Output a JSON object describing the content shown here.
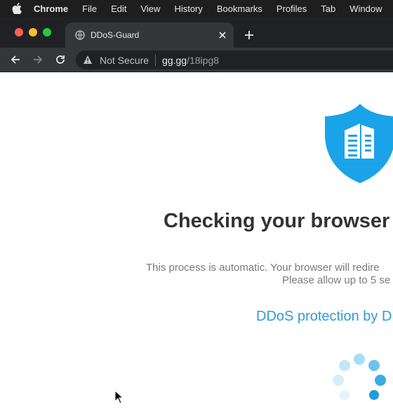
{
  "menubar": {
    "icon": "apple-icon",
    "items": [
      "Chrome",
      "File",
      "Edit",
      "View",
      "History",
      "Bookmarks",
      "Profiles",
      "Tab",
      "Window"
    ]
  },
  "tab": {
    "title": "DDoS-Guard",
    "favicon": "globe-icon"
  },
  "toolbar": {
    "security_label": "Not Secure",
    "url_host": "gg.gg",
    "url_path": "/18ipg8"
  },
  "page": {
    "headline": "Checking your browser",
    "description_line1": "This process is automatic. Your browser will redire",
    "description_line2": "Please allow up to 5 se",
    "protection_label": "DDoS protection by DI",
    "shield_icon": "shield-building-icon",
    "accent_color": "#1aa3e8"
  },
  "colors": {
    "menubar_bg": "#1e1e1e",
    "tabstrip_bg": "#202124",
    "toolbar_bg": "#35363a",
    "link": "#2f9bd6"
  }
}
